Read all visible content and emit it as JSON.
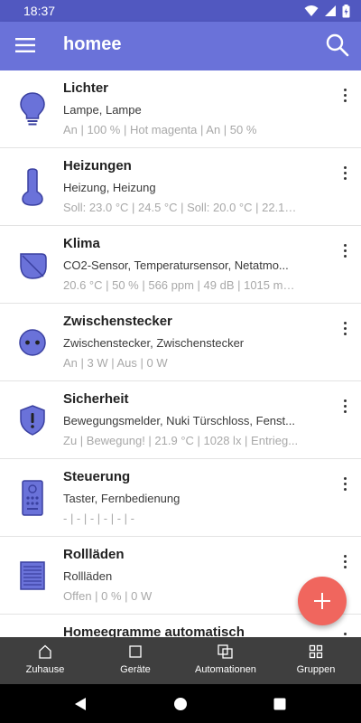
{
  "status_bar": {
    "time": "18:37"
  },
  "app_bar": {
    "title": "homee"
  },
  "colors": {
    "app_bar": "#6a72d9",
    "status_bar": "#5158c0",
    "icon": "#5158c0",
    "fab": "#f0665e",
    "bottom_nav": "#3f3f3f"
  },
  "groups": [
    {
      "title": "Lichter",
      "icon": "lightbulb-icon",
      "subtitle": "Lampe, Lampe",
      "status": "An | 100 % | Hot magenta | An | 50 %"
    },
    {
      "title": "Heizungen",
      "icon": "thermometer-icon",
      "subtitle": "Heizung, Heizung",
      "status": "Soll: 23.0 °C | 24.5 °C | Soll: 20.0 °C | 22.1 °..."
    },
    {
      "title": "Klima",
      "icon": "leaf-icon",
      "subtitle": "CO2-Sensor, Temperatursensor, Netatmo...",
      "status": "20.6 °C | 50 % | 566 ppm | 49 dB | 1015 mB..."
    },
    {
      "title": "Zwischenstecker",
      "icon": "power-socket-icon",
      "subtitle": "Zwischenstecker, Zwischenstecker",
      "status": "An | 3 W | Aus | 0 W"
    },
    {
      "title": "Sicherheit",
      "icon": "shield-alert-icon",
      "subtitle": "Bewegungsmelder, Nuki Türschloss, Fenst...",
      "status": "Zu | Bewegung! | 21.9 °C | 1028 lx | Entrieg..."
    },
    {
      "title": "Steuerung",
      "icon": "remote-control-icon",
      "subtitle": "Taster, Fernbedienung",
      "status": "- | - | - | - | - | -"
    },
    {
      "title": "Rollläden",
      "icon": "roller-shutter-icon",
      "subtitle": "Rollläden",
      "status": "Offen | 0 % | 0 W"
    },
    {
      "title": "Homeegramme automatisch",
      "icon": "",
      "subtitle": "",
      "status": ""
    }
  ],
  "fab": {
    "symbol": "+"
  },
  "bottom_nav": [
    {
      "label": "Zuhause",
      "icon": "home-icon"
    },
    {
      "label": "Geräte",
      "icon": "devices-icon"
    },
    {
      "label": "Automationen",
      "icon": "automations-icon"
    },
    {
      "label": "Gruppen",
      "icon": "groups-icon"
    }
  ]
}
